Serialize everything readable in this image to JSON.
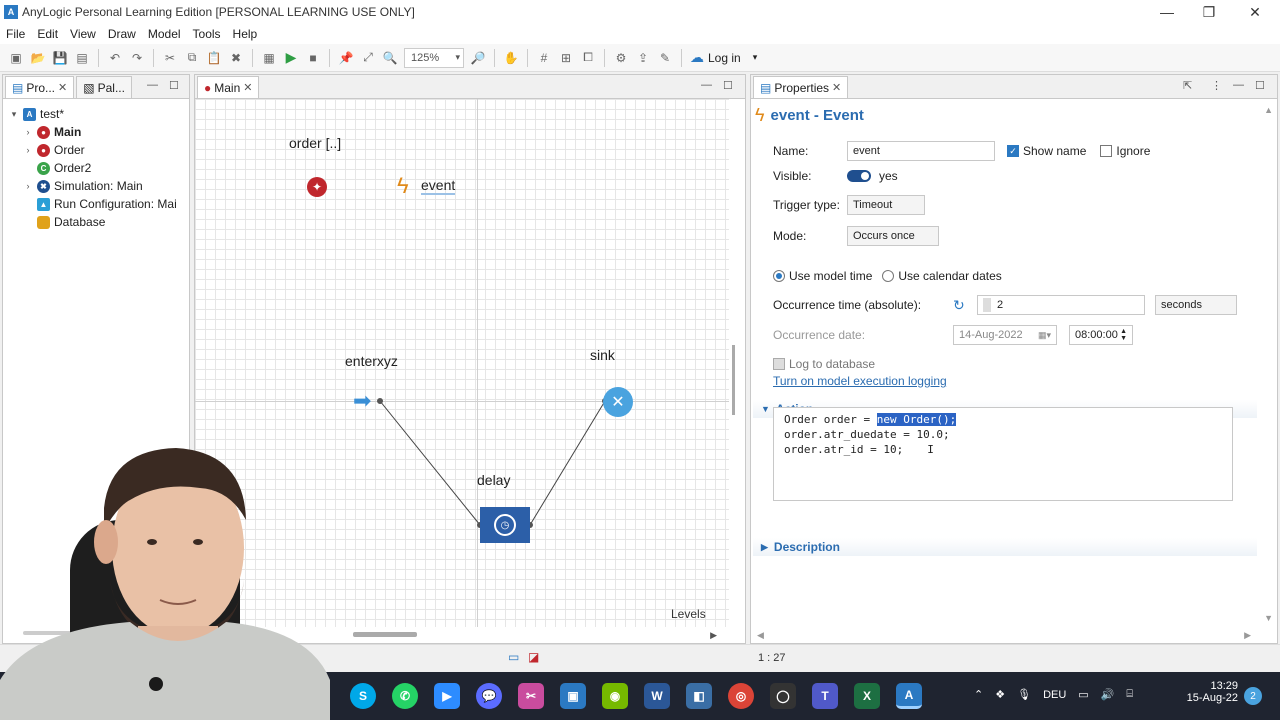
{
  "window": {
    "title": "AnyLogic Personal Learning Edition [PERSONAL LEARNING USE ONLY]",
    "controls": {
      "minimize": "—",
      "restore": "❐",
      "close": "✕"
    }
  },
  "menu": [
    "File",
    "Edit",
    "View",
    "Draw",
    "Model",
    "Tools",
    "Help"
  ],
  "toolbar": {
    "zoom": "125%",
    "login": "Log in"
  },
  "left_panel": {
    "tabs": [
      {
        "label": "Pro..."
      },
      {
        "label": "Pal..."
      }
    ],
    "tree": [
      {
        "label": "test*",
        "bold": false
      },
      {
        "label": "Main",
        "bold": true
      },
      {
        "label": "Order",
        "bold": false
      },
      {
        "label": "Order2",
        "bold": false
      },
      {
        "label": "Simulation: Main",
        "bold": false
      },
      {
        "label": "Run Configuration: Mai",
        "bold": false
      },
      {
        "label": "Database",
        "bold": false
      }
    ]
  },
  "editor": {
    "tab": "Main",
    "labels": {
      "order": "order [..]",
      "event": "event",
      "enter": "enterxyz",
      "sink": "sink",
      "delay": "delay",
      "levels": "Levels"
    }
  },
  "properties": {
    "tab": "Properties",
    "header": "event - Event",
    "name_label": "Name:",
    "name_value": "event",
    "show_name": "Show name",
    "ignore": "Ignore",
    "visible_label": "Visible:",
    "visible_value": "yes",
    "trigger_label": "Trigger type:",
    "trigger_value": "Timeout",
    "mode_label": "Mode:",
    "mode_value": "Occurs once",
    "radio_model_time": "Use model time",
    "radio_calendar": "Use calendar dates",
    "occ_time_label": "Occurrence time (absolute):",
    "occ_time_value": "2",
    "occ_time_unit": "seconds",
    "occ_date_label": "Occurrence date:",
    "occ_date_value": "14-Aug-2022",
    "occ_clock_value": "08:00:00",
    "log_db": "Log to database",
    "log_link": "Turn on model execution logging",
    "action_title": "Action",
    "code_line1_pre": "Order order = ",
    "code_line1_sel": "new Order();",
    "code_line2": "order.atr_duedate = 10.0;",
    "code_line3": "order.atr_id = 10;",
    "description_title": "Description"
  },
  "status": {
    "position": "1 : 27"
  },
  "taskbar": {
    "lang": "DEU",
    "time": "13:29",
    "date": "15-Aug-22",
    "notifications": "2"
  },
  "colors": {
    "accent": "#2b79c2",
    "agent_red": "#c0272d",
    "delay_blue": "#2c5fa8",
    "taskbar": "#1f2430"
  }
}
